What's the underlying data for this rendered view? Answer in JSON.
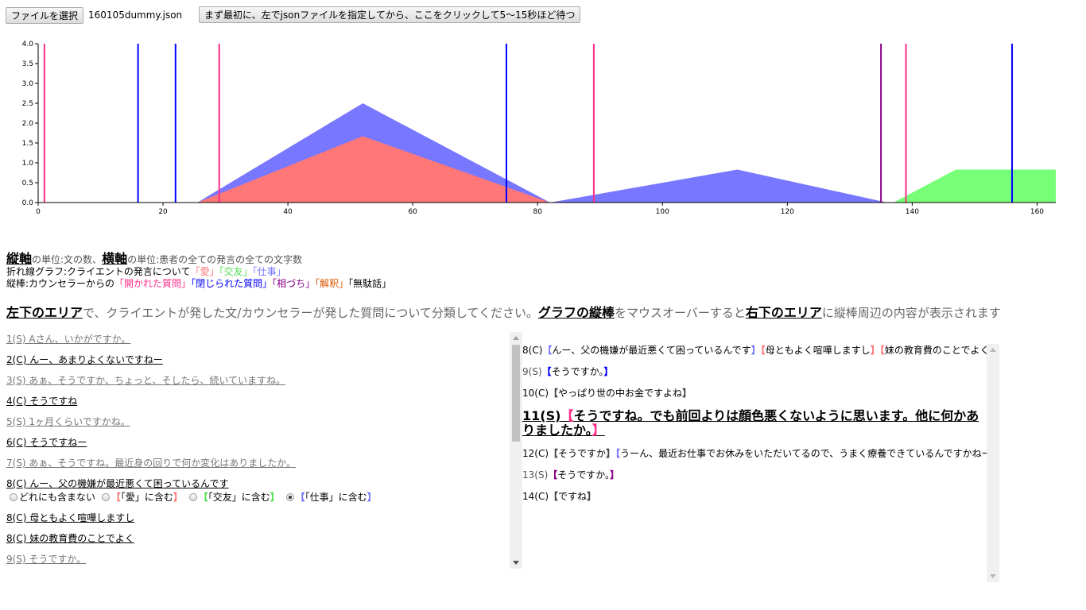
{
  "toolbar": {
    "file_button": "ファイルを選択",
    "file_name": "160105dummy.json",
    "run_button": "まず最初に、左でjsonファイルを指定してから、ここをクリックして5〜15秒ほど待つ"
  },
  "colors": {
    "ai": "#ff2d8a",
    "heisa": "#0000ff",
    "aizuchi": "#880088",
    "kaishaku": "#ff6600",
    "love": "#ff7777",
    "friend": "#77ff77",
    "work": "#7777ff"
  },
  "chart_data": {
    "type": "area",
    "xlim": [
      0,
      163
    ],
    "ylim": [
      0,
      4
    ],
    "xticks": [
      0,
      20,
      40,
      60,
      80,
      100,
      120,
      140,
      160
    ],
    "yticks": [
      "0.0",
      "0.5",
      "1.0",
      "1.5",
      "2.0",
      "2.5",
      "3.0",
      "3.5",
      "4.0"
    ],
    "areas": [
      {
        "series": "仕事",
        "color": "#7777ff",
        "points": [
          [
            25.5,
            0
          ],
          [
            52,
            2.5
          ],
          [
            82,
            0
          ],
          [
            112,
            0.83
          ],
          [
            136,
            0
          ]
        ]
      },
      {
        "series": "愛",
        "color": "#ff7777",
        "points": [
          [
            25.5,
            0
          ],
          [
            52,
            1.67
          ],
          [
            82,
            0
          ]
        ]
      },
      {
        "series": "交友",
        "color": "#77ff77",
        "points": [
          [
            137,
            0
          ],
          [
            147,
            0.83
          ],
          [
            163,
            0.83
          ],
          [
            163,
            0
          ]
        ]
      }
    ],
    "vertical_bars": [
      {
        "x": 1,
        "color": "#ff2d8a"
      },
      {
        "x": 16,
        "color": "#0000ff"
      },
      {
        "x": 22,
        "color": "#0000ff"
      },
      {
        "x": 29,
        "color": "#ff2d8a"
      },
      {
        "x": 75,
        "color": "#0000ff"
      },
      {
        "x": 89,
        "color": "#ff2d8a"
      },
      {
        "x": 135,
        "color": "#880088"
      },
      {
        "x": 139,
        "color": "#ff2d8a"
      },
      {
        "x": 156,
        "color": "#0000ff"
      }
    ]
  },
  "legend": {
    "vertical_axis": "縦軸",
    "vertical_unit": "の単位:文の数、",
    "horizontal_axis": "横軸",
    "horizontal_unit": "の単位:患者の全ての発言の全ての文字数",
    "line_graph_prefix": "折れ線グラフ:クライエントの発言について",
    "love": "「愛」",
    "friend": "「交友」",
    "work": "「仕事」",
    "bars_prefix": "縦棒:カウンセラーからの",
    "open_q": "「開かれた質問」",
    "closed_q": "「閉じられた質問」",
    "aizuchi": "「相づち」",
    "kaishaku": "「解釈」",
    "muda": "「無駄話」"
  },
  "instructions": {
    "area_left": "左下のエリア",
    "text1": "で、クライエントが発した文/カウンセラーが発した質問について分類してください。",
    "graph_bar": "グラフの縦棒",
    "text2": "をマウスオーバーすると",
    "area_right": "右下のエリア",
    "text3": "に縦棒周辺の内容が表示されます"
  },
  "left_list": {
    "items": [
      {
        "speaker": "s",
        "text": "1(S) Aさん、いかがですか。"
      },
      {
        "speaker": "c",
        "text": "2(C) んー、あまりよくないですねー"
      },
      {
        "speaker": "s",
        "text": "3(S) あぁ、そうですか、ちょっと、そしたら、続いていますね。"
      },
      {
        "speaker": "c",
        "text": "4(C) そうですね"
      },
      {
        "speaker": "s",
        "text": "5(S) 1ヶ月くらいですかね。"
      },
      {
        "speaker": "c",
        "text": "6(C) そうですねー"
      },
      {
        "speaker": "s",
        "text": "7(S) あぁ、そうですね。最近身の回りで何か変化はありましたか。"
      },
      {
        "speaker": "c",
        "text": "8(C) んー、父の機嫌が最近悪くて困っているんです"
      }
    ],
    "radio_options": {
      "none": "どれにも含まない",
      "love": "「愛」に含む",
      "friend": "「交友」に含む",
      "work": "「仕事」に含む"
    },
    "items_after": [
      {
        "speaker": "c",
        "text": "8(C) 母ともよく喧嘩しますし"
      },
      {
        "speaker": "c",
        "text": "8(C) 妹の教育費のことでよく"
      },
      {
        "speaker": "s",
        "text": "9(S) そうですか。"
      }
    ]
  },
  "right_panel": {
    "line8": {
      "label": "8(C)",
      "seg1": "んー、父の機嫌が最近悪くて困っているんです",
      "seg2": "母ともよく喧嘩しますし",
      "seg3": "妹の教育費のことでよく"
    },
    "line9": {
      "label": "9(S)",
      "text": "そうですか。"
    },
    "line10": {
      "label": "10(C)",
      "text": "やっぱり世の中お金ですよね"
    },
    "line11": {
      "label": "11(S)",
      "text": "そうですね。でも前回よりは顔色悪くないように思います。他に何かありましたか。"
    },
    "line12": {
      "label": "12(C)",
      "seg1": "そうですか",
      "seg2": "うーん、最近お仕事でお休みをいただいてるので、うまく療養できているんですかねー"
    },
    "line13": {
      "label": "13(S)",
      "text": "そうですか。"
    },
    "line14": {
      "label": "14(C)",
      "text": "ですね"
    }
  }
}
